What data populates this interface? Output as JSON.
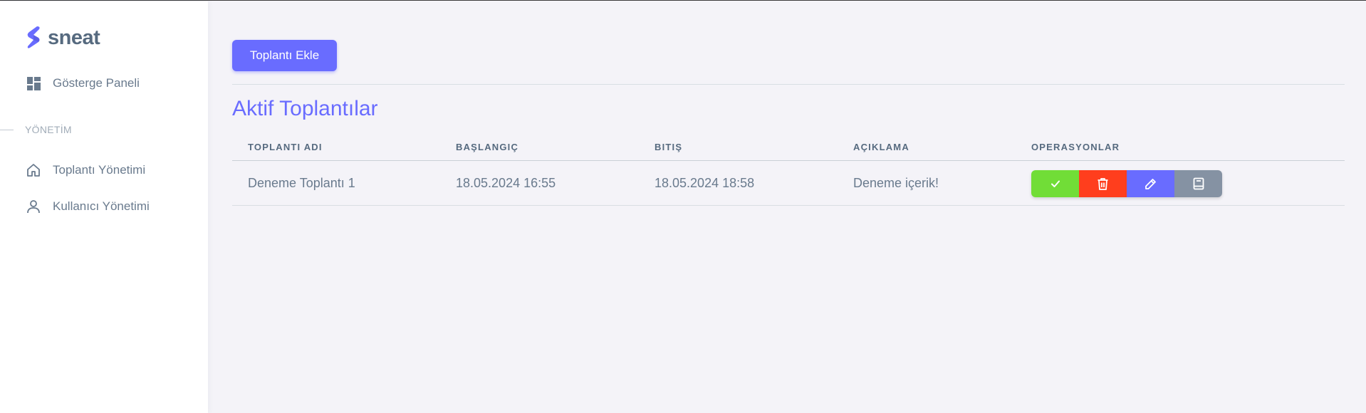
{
  "brand": {
    "name": "sneat"
  },
  "sidebar": {
    "dashboard": {
      "label": "Gösterge Paneli",
      "icon": "dashboard-icon"
    },
    "section_header": "YÖNETİM",
    "items": [
      {
        "label": "Toplantı Yönetimi",
        "icon": "home-icon"
      },
      {
        "label": "Kullanıcı Yönetimi",
        "icon": "user-icon"
      }
    ]
  },
  "main": {
    "add_button": "Toplantı Ekle",
    "section_title": "Aktif Toplantılar",
    "table": {
      "headers": [
        "TOPLANTI ADI",
        "BAŞLANGIÇ",
        "BITIŞ",
        "AÇIKLAMA",
        "OPERASYONLAR"
      ],
      "rows": [
        {
          "name": "Deneme Toplantı 1",
          "start": "18.05.2024 16:55",
          "end": "18.05.2024 18:58",
          "description": "Deneme içerik!"
        }
      ]
    },
    "operations": [
      {
        "name": "approve",
        "icon": "check-icon",
        "color": "#71dd37"
      },
      {
        "name": "delete",
        "icon": "trash-icon",
        "color": "#ff3e1d"
      },
      {
        "name": "edit",
        "icon": "pencil-icon",
        "color": "#696cff"
      },
      {
        "name": "details",
        "icon": "book-icon",
        "color": "#8592a3"
      }
    ]
  },
  "colors": {
    "primary": "#696cff",
    "success": "#71dd37",
    "danger": "#ff3e1d",
    "secondary": "#8592a3",
    "background": "#f4f3f8"
  }
}
